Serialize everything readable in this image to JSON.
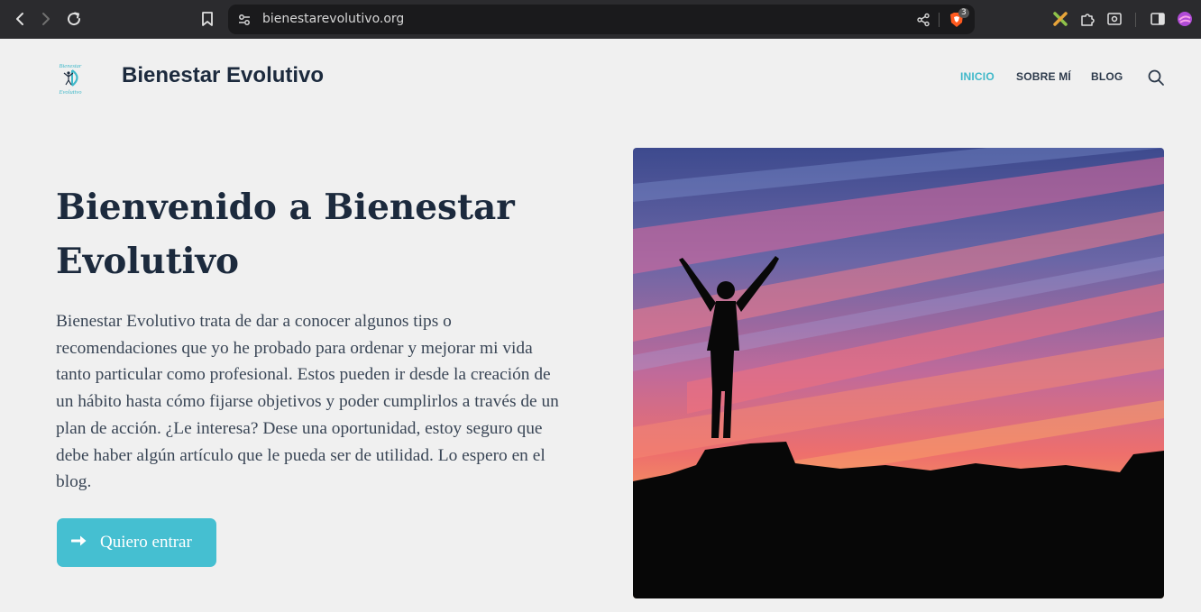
{
  "browser": {
    "url": "bienestarevolutivo.org",
    "shields_count": "3",
    "icons": [
      "back-icon",
      "forward-icon",
      "reload-icon",
      "bookmark-icon",
      "site-settings-icon",
      "share-icon",
      "brave-shields-icon",
      "extension-x-icon",
      "extensions-puzzle-icon",
      "screenshot-icon",
      "sidebar-icon",
      "profile-icon"
    ]
  },
  "site": {
    "logo_text_top": "Bienestar",
    "logo_text_bottom": "Evolutivo",
    "title": "Bienestar Evolutivo",
    "menu": [
      "INICIO",
      "SOBRE MÍ",
      "BLOG"
    ],
    "active_menu": "INICIO"
  },
  "hero": {
    "title": "Bienvenido a Bienestar Evolutivo",
    "text": "Bienestar Evolutivo trata de dar a conocer algunos tips o recomendaciones que yo he probado para ordenar y mejorar mi vida tanto particular como profesional. Estos pueden ir desde la creación de un hábito hasta cómo fijarse objetivos y poder cumplirlos a través de un plan de acción. ¿Le interesa? Dese una oportunidad, estoy seguro que debe haber algún artículo que le pueda ser de utilidad. Lo espero en el blog.",
    "cta_label": "Quiero entrar"
  },
  "colors": {
    "accent": "#45bfd1",
    "active_menu": "#3fb8c9",
    "heading": "#1c2a3d"
  }
}
